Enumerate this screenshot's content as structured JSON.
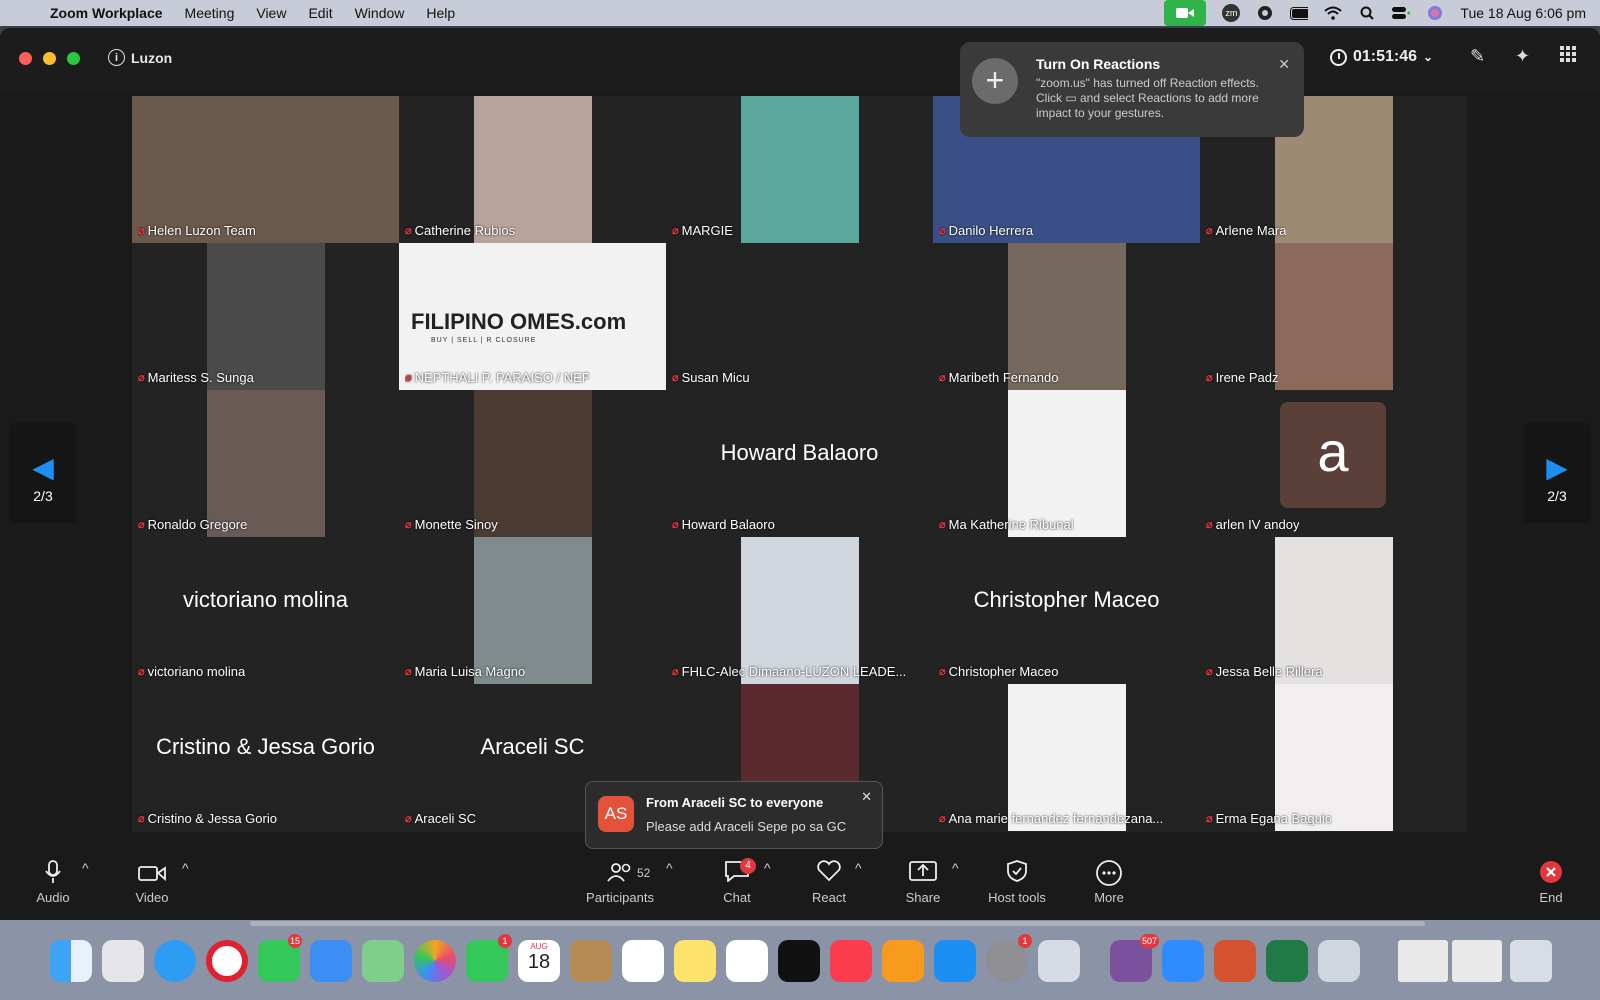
{
  "menubar": {
    "app_name": "Zoom Workplace",
    "items": [
      "Meeting",
      "View",
      "Edit",
      "Window",
      "Help"
    ],
    "datetime": "Tue 18 Aug  6:06 pm",
    "zoom_status_text": "zm"
  },
  "window": {
    "meeting_name": "Luzon",
    "timer": "01:51:46"
  },
  "reactions_popup": {
    "title": "Turn On Reactions",
    "body": "\"zoom.us\" has turned off Reaction effects. Click ▭ and select Reactions to add more impact to your gestures."
  },
  "tiles": [
    {
      "name": "Helen Luzon Team",
      "big_name": "",
      "bg": "#6b5a4c"
    },
    {
      "name": "Catherine  Rubios",
      "big_name": "",
      "bg": "#b7a39b"
    },
    {
      "name": "MARGIE",
      "big_name": "",
      "bg": "#5aa89b"
    },
    {
      "name": "Danilo Herrera",
      "big_name": "",
      "bg": "#3a4f86"
    },
    {
      "name": "Arlene Mara",
      "big_name": "",
      "bg": "#9c8a72"
    },
    {
      "name": "Maritess S. Sunga",
      "big_name": "",
      "bg": "#4a4a4a"
    },
    {
      "name": "NEPTHALI P. PARAISO / NEP",
      "big_name": "",
      "bg": "#f2f2f2",
      "logo": "FILIPINO  OMES.com",
      "logo_sub": "BUY | SELL | R      CLOSURE"
    },
    {
      "name": "Susan Micu",
      "big_name": "",
      "bg": ""
    },
    {
      "name": "Maribeth Fernando",
      "big_name": "",
      "bg": "#75685c"
    },
    {
      "name": "Irene Padz",
      "big_name": "",
      "bg": "#8c6a5b"
    },
    {
      "name": "Ronaldo Gregore",
      "big_name": "",
      "bg": "#6a5a55"
    },
    {
      "name": "Monette Sinoy",
      "big_name": "",
      "bg": "#4b3b33"
    },
    {
      "name": "Howard Balaoro",
      "big_name": "Howard Balaoro",
      "bg": ""
    },
    {
      "name": "Ma Katherine Ribunal",
      "big_name": "",
      "bg": "#f2f2f2"
    },
    {
      "name": "arlen IV andoy",
      "big_name": "",
      "bg": "",
      "avatar_letter": "a"
    },
    {
      "name": "victoriano molina",
      "big_name": "victoriano molina",
      "bg": ""
    },
    {
      "name": "Maria Luisa Magno",
      "big_name": "",
      "bg": "#7f8b8d"
    },
    {
      "name": "FHLC-Alec Dimaano-LUZON LEADE...",
      "big_name": "",
      "bg": "#cfd6de"
    },
    {
      "name": "Christopher Maceo",
      "big_name": "Christopher Maceo",
      "bg": ""
    },
    {
      "name": "Jessa Belle Rillera",
      "big_name": "",
      "bg": "#e4e2e0"
    },
    {
      "name": "Cristino & Jessa Gorio",
      "big_name": "Cristino & Jessa Gorio",
      "bg": ""
    },
    {
      "name": "Araceli SC",
      "big_name": "Araceli SC",
      "bg": ""
    },
    {
      "name": "",
      "big_name": "",
      "bg": "#5a2a2e"
    },
    {
      "name": "Ana marie fernandez fernandezana...",
      "big_name": "",
      "bg": "#f2f2f2"
    },
    {
      "name": "Erma Egana Baguio",
      "big_name": "",
      "bg": "#f0eeee"
    }
  ],
  "pager": {
    "label": "2/3"
  },
  "chat_popup": {
    "initials": "AS",
    "from": "From Araceli SC to everyone",
    "message": "Please add Araceli Sepe po sa GC"
  },
  "toolbar": {
    "audio": "Audio",
    "video": "Video",
    "participants": "Participants",
    "participants_count": "52",
    "chat": "Chat",
    "chat_badge": "4",
    "react": "React",
    "share": "Share",
    "host_tools": "Host tools",
    "more": "More",
    "end": "End"
  },
  "dock": {
    "calendar_month": "AUG",
    "calendar_day": "18",
    "badges": {
      "messages": "15",
      "facetime": "1",
      "settings": "1",
      "viber": "507"
    }
  }
}
